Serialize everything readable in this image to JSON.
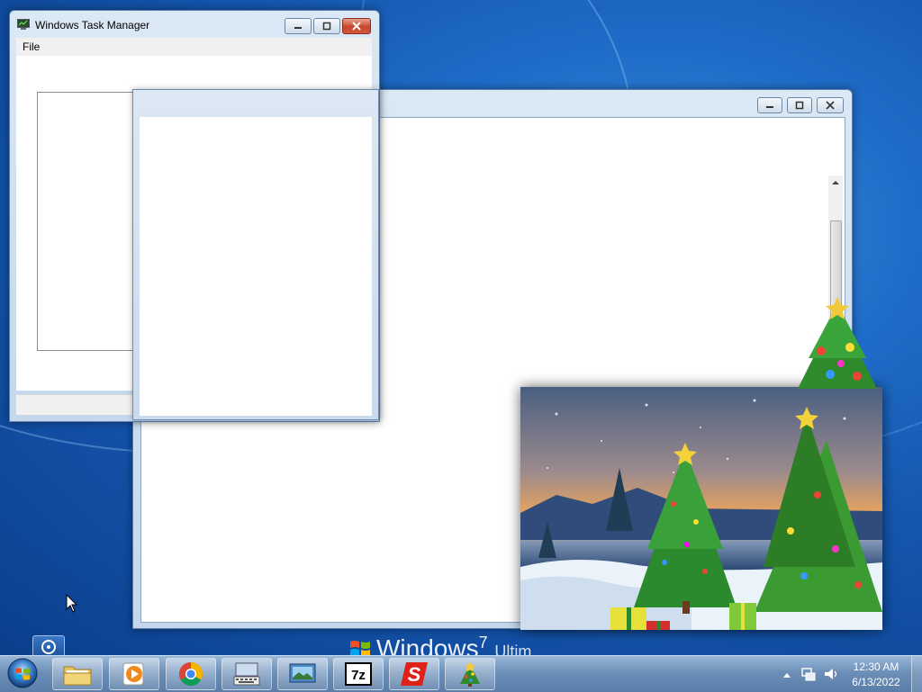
{
  "desktop": {
    "logo_text": "Windows",
    "logo_version": "7",
    "logo_edition": "Ultim"
  },
  "task_manager": {
    "title": "Windows Task Manager",
    "menu": [
      "File"
    ]
  },
  "main_window": {
    "title": ""
  },
  "small_window": {
    "title": ""
  },
  "taskbar": {
    "items": [
      {
        "name": "Windows Explorer",
        "icon": "folder-icon"
      },
      {
        "name": "Media Player",
        "icon": "media-player-icon"
      },
      {
        "name": "Google Chrome",
        "icon": "chrome-icon"
      },
      {
        "name": "On-Screen Keyboard",
        "icon": "keyboard-icon"
      },
      {
        "name": "Screen Capture",
        "icon": "screen-capture-icon"
      },
      {
        "name": "7-Zip",
        "icon": "seven-zip-icon",
        "label": "7z"
      },
      {
        "name": "App S",
        "icon": "s-app-icon",
        "label": "S"
      },
      {
        "name": "Christmas Tree",
        "icon": "christmas-tree-icon"
      }
    ]
  },
  "tray": {
    "time": "12:30 AM",
    "date": "6/13/2022"
  },
  "colors": {
    "desktop_blue": "#1f6cc8",
    "close_red": "#c7462d",
    "taskbar": "#6c8fb8"
  }
}
